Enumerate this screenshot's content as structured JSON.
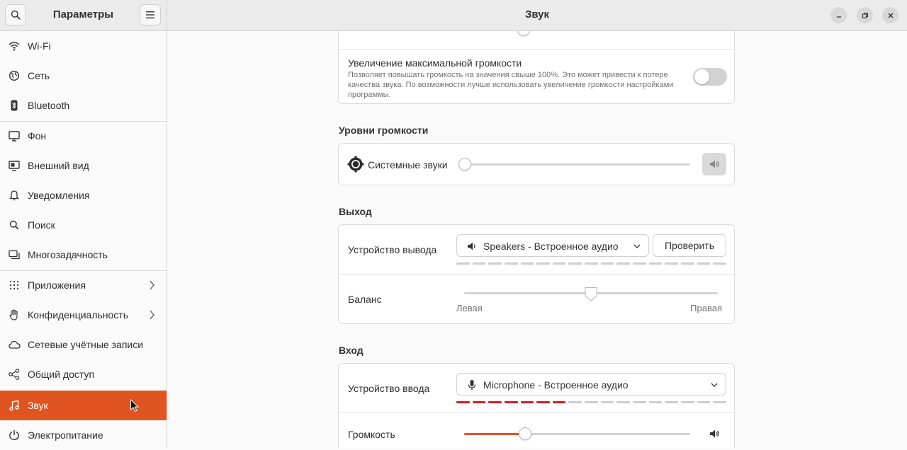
{
  "header": {
    "left_title": "Параметры",
    "title": "Звук"
  },
  "sidebar": {
    "items": [
      {
        "label": "Wi-Fi",
        "icon": "wifi-icon"
      },
      {
        "label": "Сеть",
        "icon": "network-icon"
      },
      {
        "label": "Bluetooth",
        "icon": "bluetooth-icon"
      },
      {
        "label": "Фон",
        "icon": "background-icon"
      },
      {
        "label": "Внешний вид",
        "icon": "appearance-icon"
      },
      {
        "label": "Уведомления",
        "icon": "bell-icon"
      },
      {
        "label": "Поиск",
        "icon": "search-icon"
      },
      {
        "label": "Многозадачность",
        "icon": "multitasking-icon"
      },
      {
        "label": "Приложения",
        "icon": "apps-grid-icon"
      },
      {
        "label": "Конфиденциальность",
        "icon": "hand-icon"
      },
      {
        "label": "Сетевые учётные записи",
        "icon": "cloud-icon"
      },
      {
        "label": "Общий доступ",
        "icon": "share-icon"
      },
      {
        "label": "Звук",
        "icon": "music-note-icon"
      },
      {
        "label": "Электропитание",
        "icon": "power-icon"
      }
    ]
  },
  "overamp": {
    "title": "Увеличение максимальной громкости",
    "description": "Позволяет повышать громкость на значения свыше 100%. Это может привести к потере качества звука. По возможности лучше использовать увеличение громкости настройками программы.",
    "enabled": false
  },
  "volume_levels": {
    "section_title": "Уровни громкости",
    "system_sounds_label": "Системные звуки",
    "system_sounds_level": 0
  },
  "output": {
    "section_title": "Выход",
    "device_label": "Устройство вывода",
    "device_value": "Speakers - Встроенное аудио",
    "test_button": "Проверить",
    "level_segments_on": 0,
    "level_segments_total": 17,
    "balance_label": "Баланс",
    "balance_left": "Левая",
    "balance_right": "Правая",
    "balance_value": 0.5
  },
  "input": {
    "section_title": "Вход",
    "device_label": "Устройство ввода",
    "device_value": "Microphone - Встроенное аудио",
    "level_segments_on": 7,
    "level_segments_total": 17,
    "volume_label": "Громкость",
    "volume_value": 0.27
  },
  "colors": {
    "accent": "#e05422",
    "mic_level": "#e01b24"
  }
}
